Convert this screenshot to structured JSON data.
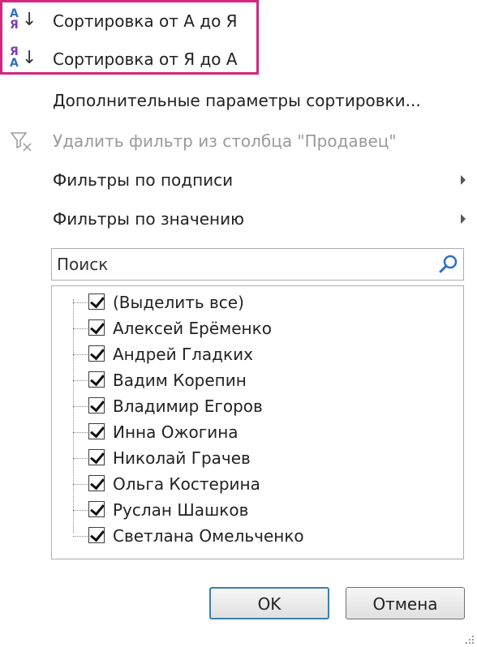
{
  "menu": {
    "sort_az": {
      "letter_top": "А",
      "letter_bottom": "Я",
      "label": "Сортировка от А до Я"
    },
    "sort_za": {
      "letter_top": "Я",
      "letter_bottom": "А",
      "label": "Сортировка от Я до А"
    },
    "more_sort": "Дополнительные параметры сортировки...",
    "clear_filter": "Удалить фильтр из столбца \"Продавец\"",
    "label_filters": "Фильтры по подписи",
    "value_filters": "Фильтры по значению"
  },
  "search": {
    "placeholder": "Поиск"
  },
  "filter_list": [
    {
      "label": "(Выделить все)",
      "checked": true
    },
    {
      "label": "Алексей Ерёменко",
      "checked": true
    },
    {
      "label": "Андрей Гладких",
      "checked": true
    },
    {
      "label": "Вадим Корепин",
      "checked": true
    },
    {
      "label": "Владимир Егоров",
      "checked": true
    },
    {
      "label": "Инна Ожогина",
      "checked": true
    },
    {
      "label": "Николай Грачев",
      "checked": true
    },
    {
      "label": "Ольга Костерина",
      "checked": true
    },
    {
      "label": "Руслан Шашков",
      "checked": true
    },
    {
      "label": "Светлана Омельченко",
      "checked": true
    }
  ],
  "buttons": {
    "ok": "OK",
    "cancel": "Отмена"
  },
  "colors": {
    "highlight": "#d4267f",
    "accent_blue": "#3c7fb1",
    "letter_blue": "#2f6fc0",
    "letter_purple": "#7b3fb5"
  }
}
